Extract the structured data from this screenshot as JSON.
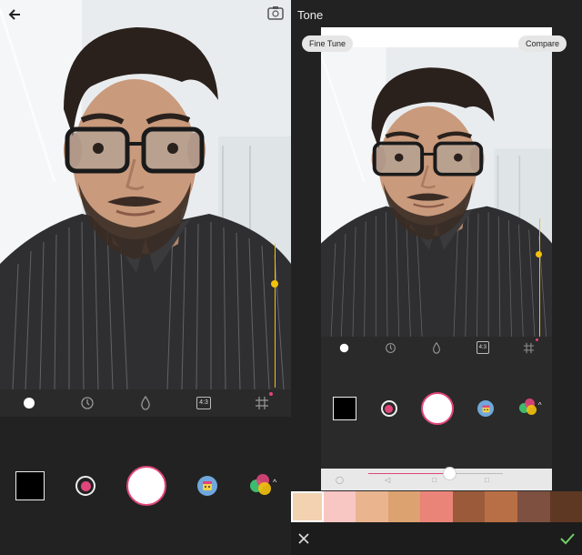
{
  "left": {
    "icons": [
      "back-arrow-icon",
      "flip-camera-icon"
    ],
    "modes": [
      {
        "name": "dot-mode-icon"
      },
      {
        "name": "timer-icon"
      },
      {
        "name": "drop-icon"
      },
      {
        "name": "aspect-ratio-icon",
        "label": "4:3"
      },
      {
        "name": "grid-icon"
      }
    ],
    "controls": [
      "gallery-thumbnail",
      "beauty-mode-button",
      "shutter-button",
      "sticker-button",
      "filters-button"
    ]
  },
  "right": {
    "title": "Tone",
    "fine_tune_label": "Fine Tune",
    "compare_label": "Compare",
    "mini_modes": [
      {
        "name": "dot-mode-icon"
      },
      {
        "name": "timer-icon"
      },
      {
        "name": "drop-icon"
      },
      {
        "name": "aspect-ratio-icon",
        "label": "4:3"
      },
      {
        "name": "grid-icon"
      }
    ],
    "slider": {
      "value_fraction": 0.6
    },
    "swatches": [
      "#f2d2b0",
      "#f8c6c3",
      "#e9b48e",
      "#dca270",
      "#eb8478",
      "#9b5a3a",
      "#b96f45",
      "#7d5040",
      "#5e3823"
    ],
    "selected_swatch": 0
  },
  "colors": {
    "accent": "#e0457b",
    "exposure": "#f4c20d",
    "confirm": "#6ecf68"
  }
}
